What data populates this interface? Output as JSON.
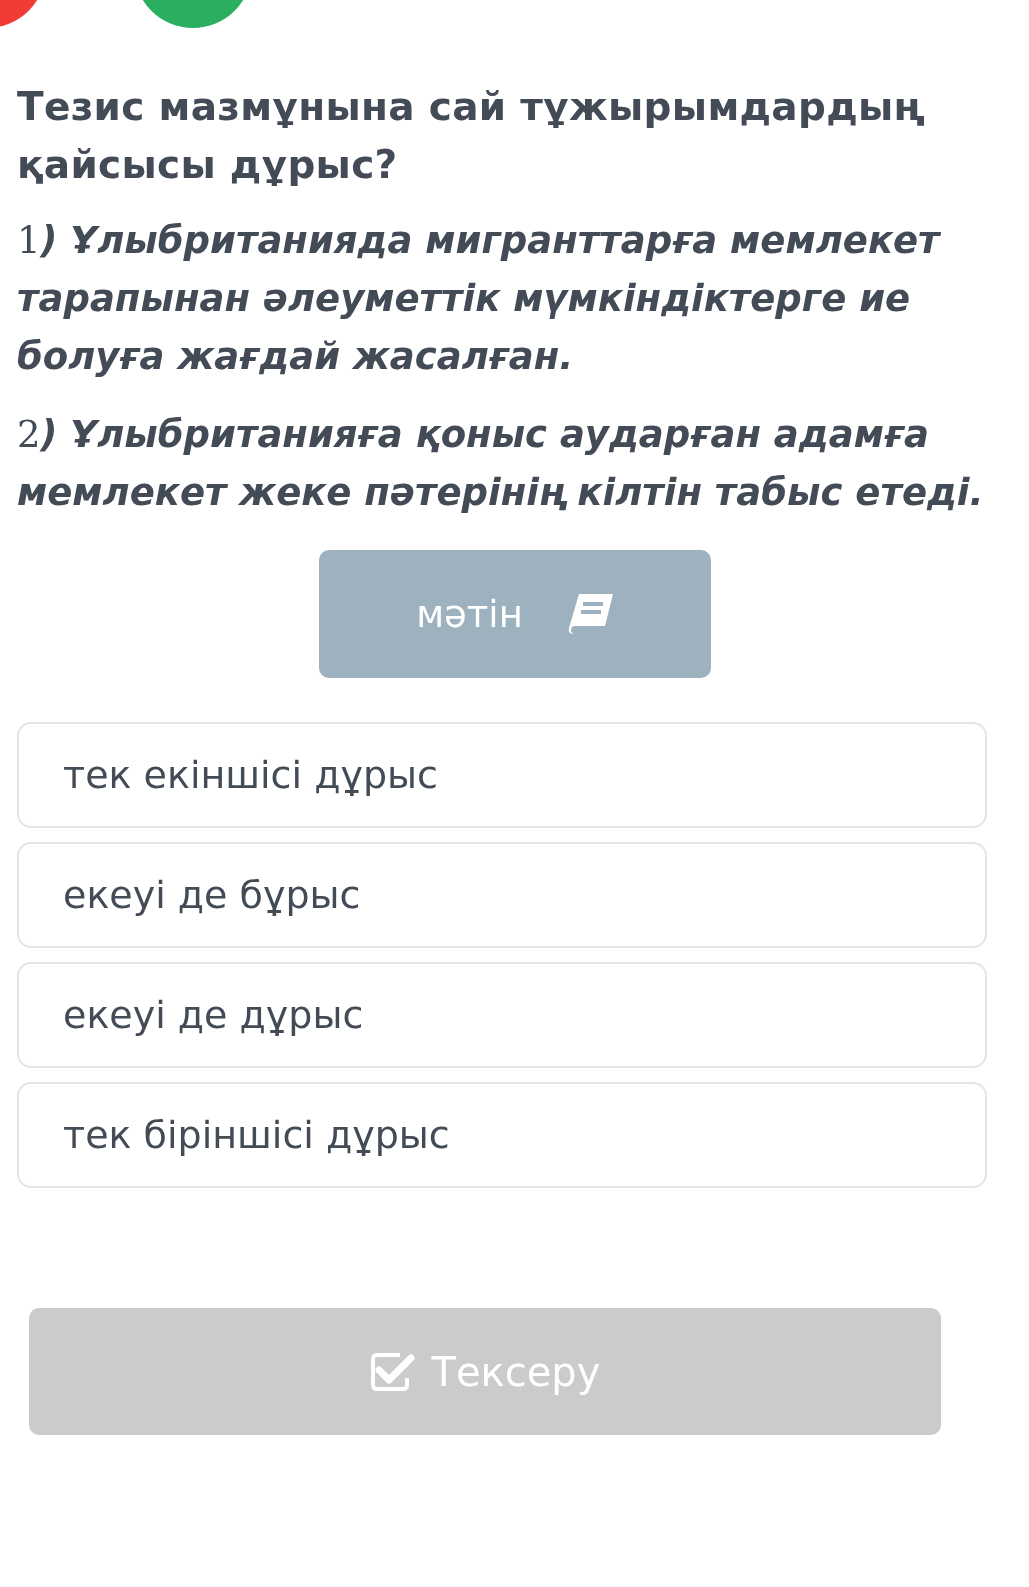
{
  "indicators": [
    {
      "color": "#f23b35"
    },
    {
      "color": "#2aae60"
    }
  ],
  "question": "Тезис мазмұнына сай тұжырымдардың қайсысы дұрыс?",
  "statements": [
    {
      "number": "1",
      "text": ") Ұлыбританияда мигранттарға мемлекет тарапынан әлеуметтік мүмкіндіктерге ие болуға жағдай жасалған."
    },
    {
      "number": "2",
      "text": ") Ұлыбританияға қоныс аударған адамға мемлекет жеке пәтерінің кілтін табыс етеді."
    }
  ],
  "text_button": {
    "label": "мәтін"
  },
  "options": [
    {
      "label": "тек екіншісі дұрыс",
      "selected": false
    },
    {
      "label": "екеуі де бұрыс",
      "selected": false
    },
    {
      "label": "екеуі де дұрыс",
      "selected": false
    },
    {
      "label": "тек біріншісі дұрыс",
      "selected": false
    }
  ],
  "check_button": {
    "label": "Тексеру",
    "disabled": true
  }
}
